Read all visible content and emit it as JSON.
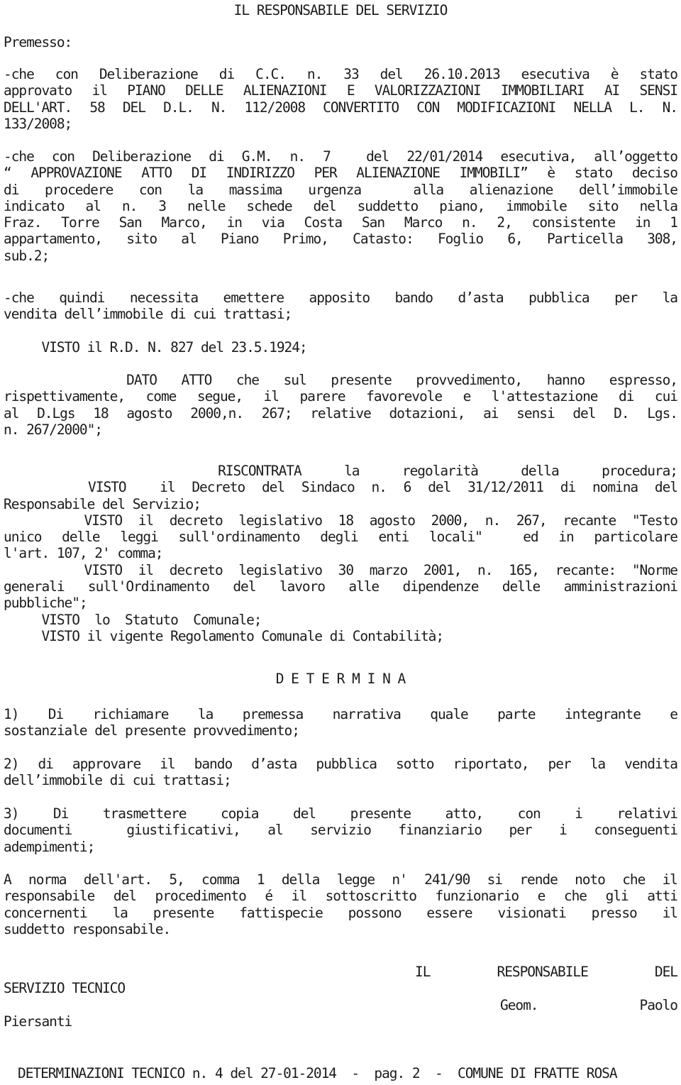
{
  "document": {
    "type": "determinazione",
    "title": "IL RESPONSABILE DEL SERVIZIO",
    "heading_premesso": "Premesso:",
    "determina_heading": "D E T E R M I N A",
    "paragraphs": {
      "p1": {
        "lines": [
          "-che con Deliberazione di C.C. n. 33 del 26.10.2013 esecutiva è stato",
          "approvato il PIANO DELLE ALIENAZIONI E VALORIZZAZIONI IMMOBILIARI AI SENSI",
          "DELL'ART. 58 DEL D.L. N. 112/2008 CONVERTITO CON MODIFICAZIONI NELLA L. N.",
          "133/2008;"
        ]
      },
      "p2": {
        "lines": [
          "-che con Deliberazione di G.M. n. 7  del 22/01/2014 esecutiva, all’oggetto",
          "“ APPROVAZIONE ATTO DI INDIRIZZO PER ALIENAZIONE IMMOBILI” è stato deciso",
          "di procedere con la massima urgenza  alla alienazione dell’immobile",
          "indicato al n. 3 nelle schede del suddetto piano, immobile sito nella",
          "Fraz. Torre San Marco, in via Costa San Marco n. 2, consistente in 1",
          "appartamento, sito al Piano Primo, Catasto: Foglio 6, Particella 308,",
          "sub.2;"
        ]
      },
      "p3": {
        "lines": [
          "-che quindi necessita emettere apposito bando d’asta pubblica per la",
          "vendita dell’immobile di cui trattasi;"
        ]
      },
      "p4": {
        "lines": [
          "     VISTO il R.D. N. 827 del 23.5.1924;"
        ]
      },
      "p5": {
        "lines": [
          "     DATO ATTO che sul presente provvedimento, hanno espresso,",
          "rispettivamente, come segue, il parere favorevole e l'attestazione di cui",
          "al D.Lgs 18 agosto 2000,n. 267; relative dotazioni, ai sensi del D. Lgs.",
          "n. 267/2000\";"
        ]
      },
      "p6": {
        "lines": [
          "     RISCONTRATA la regolarità della procedura;",
          "     VISTO  il Decreto del Sindaco n. 6 del 31/12/2011 di nomina del",
          "Responsabile del Servizio;",
          "     VISTO il decreto legislativo 18 agosto 2000, n. 267, recante \"Testo",
          "unico delle leggi sull'ordinamento degli enti locali\"  ed in particolare",
          "l'art. 107, 2' comma;",
          "     VISTO il decreto legislativo 30 marzo 2001, n. 165, recante: \"Norme",
          "generali sull'Ordinamento del lavoro alle dipendenze delle amministrazioni",
          "pubbliche\";",
          "     VISTO  lo  Statuto  Comunale;",
          "     VISTO il vigente Regolamento Comunale di Contabilità;"
        ]
      },
      "p7": {
        "lines": [
          "1) Di richiamare la premessa narrativa quale parte integrante e",
          "sostanziale del presente provvedimento;"
        ]
      },
      "p8": {
        "lines": [
          "2) di approvare il bando d’asta pubblica sotto riportato, per la vendita",
          "dell’immobile di cui trattasi;"
        ]
      },
      "p9": {
        "lines": [
          "3) Di trasmettere copia del presente atto, con i relativi",
          "documenti  giustificativi, al servizio finanziario per i conseguenti",
          "adempimenti;"
        ]
      },
      "p10": {
        "lines": [
          "A norma dell'art. 5, comma 1 della legge n' 241/90 si rende noto che il",
          "responsabile del procedimento é il sottoscritto funzionario e che gli atti",
          "concernenti la presente fattispecie possono essere visionati presso il",
          "suddetto responsabile."
        ]
      }
    },
    "signature": {
      "lines": [
        "                              IL RESPONSABILE DEL",
        "SERVIZIO TECNICO",
        "                                        Geom. Paolo",
        "Piersanti"
      ],
      "role_line_1_words": [
        "IL",
        "RESPONSABILE",
        "DEL"
      ],
      "role_line_2": "SERVIZIO TECNICO",
      "name_line_1_words": [
        "Geom.",
        "Paolo"
      ],
      "name_line_2": "Piersanti"
    },
    "footer": "DETERMINAZIONI TECNICO n. 4 del 27-01-2014  -  pag. 2  -  COMUNE DI FRATTE ROSA",
    "footer_parts": {
      "register": "DETERMINAZIONI TECNICO",
      "number_label": "n. 4",
      "date_label": "del 27-01-2014",
      "page_label": "pag. 2",
      "entity": "COMUNE DI FRATTE ROSA"
    },
    "colors": {
      "background": "#ffffff",
      "text": "#1b1b1b"
    }
  }
}
